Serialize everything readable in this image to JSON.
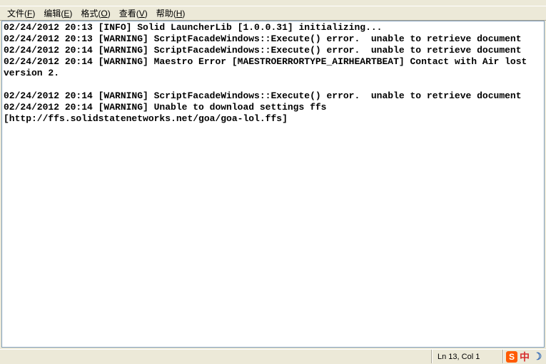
{
  "menu": {
    "items": [
      {
        "label": "文件",
        "accel": "F"
      },
      {
        "label": "编辑",
        "accel": "E"
      },
      {
        "label": "格式",
        "accel": "O"
      },
      {
        "label": "查看",
        "accel": "V"
      },
      {
        "label": "帮助",
        "accel": "H"
      }
    ]
  },
  "log_text": "02/24/2012 20:13 [INFO] Solid LauncherLib [1.0.0.31] initializing...\n02/24/2012 20:13 [WARNING] ScriptFacadeWindows::Execute() error.  unable to retrieve document\n02/24/2012 20:14 [WARNING] ScriptFacadeWindows::Execute() error.  unable to retrieve document\n02/24/2012 20:14 [WARNING] Maestro Error [MAESTROERRORTYPE_AIRHEARTBEAT] Contact with Air lost version 2.\n\n02/24/2012 20:14 [WARNING] ScriptFacadeWindows::Execute() error.  unable to retrieve document\n02/24/2012 20:14 [WARNING] Unable to download settings ffs [http://ffs.solidstatenetworks.net/goa/goa-lol.ffs]\n",
  "status": {
    "position": "Ln 13, Col 1"
  },
  "tray": {
    "s": "S",
    "zhong": "中",
    "moon": "☽"
  }
}
